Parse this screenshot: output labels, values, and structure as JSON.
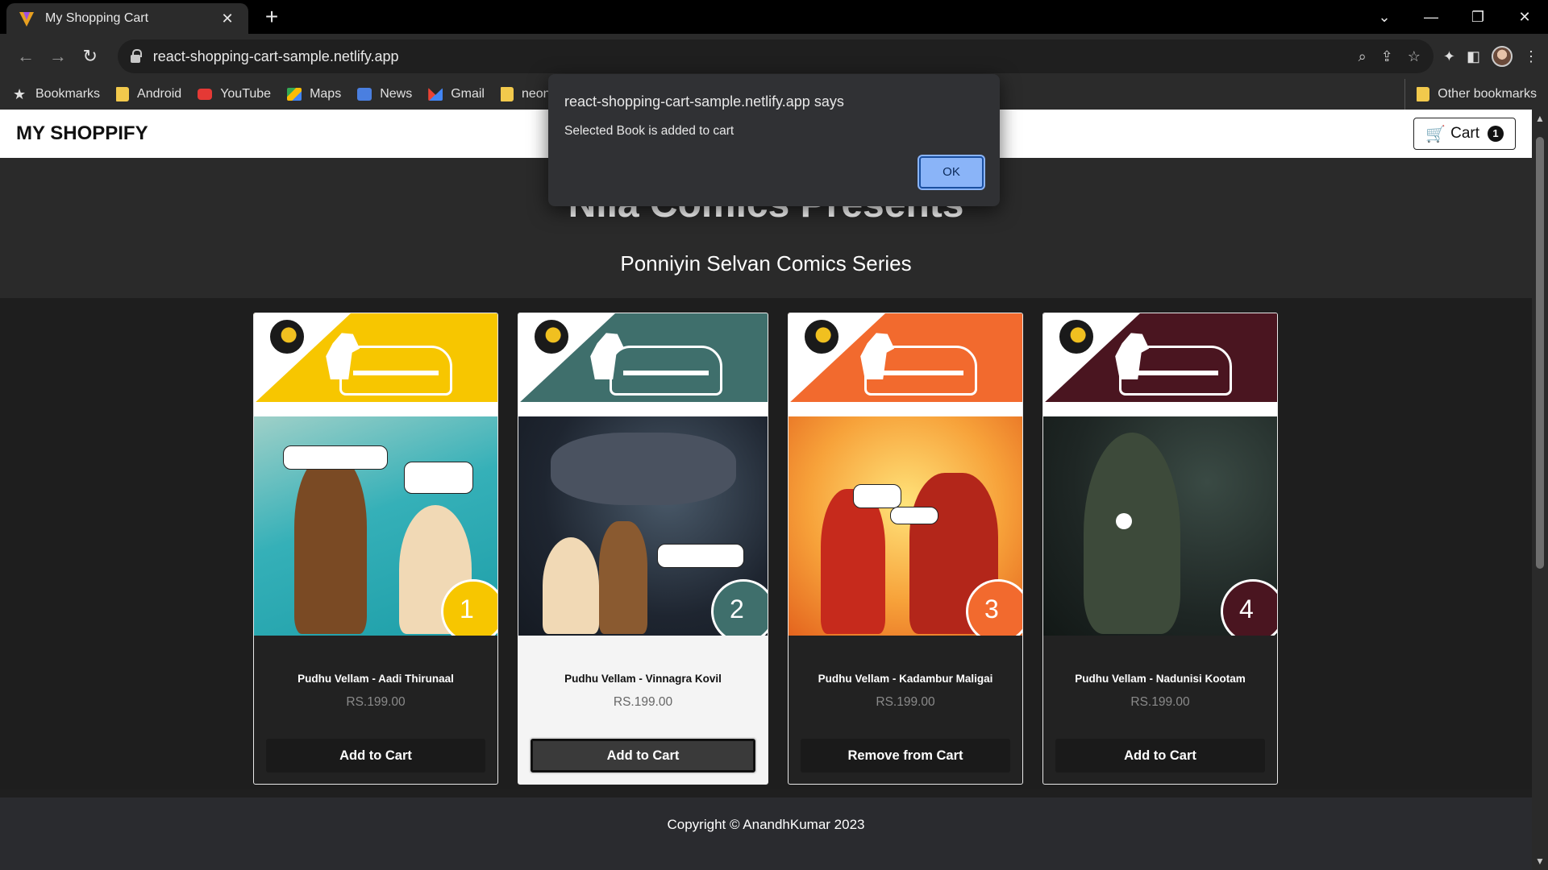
{
  "browser": {
    "tab_title": "My Shopping Cart",
    "tab_close": "✕",
    "new_tab": "+",
    "url": "react-shopping-cart-sample.netlify.app",
    "window_controls": {
      "chevron": "⌄",
      "minimize": "—",
      "restore": "❐",
      "close": "✕"
    },
    "nav": {
      "back": "←",
      "forward": "→",
      "reload": "↻"
    },
    "omni_icons": {
      "zoom": "⌕",
      "share": "⇪",
      "star": "☆"
    },
    "toolbar_icons": {
      "extensions": "✦",
      "sidepanel": "◧",
      "menu": "⋮"
    }
  },
  "bookmarks": [
    {
      "label": "Bookmarks",
      "icon": "star-icon"
    },
    {
      "label": "Android",
      "icon": "folder-icon"
    },
    {
      "label": "YouTube",
      "icon": "youtube-icon"
    },
    {
      "label": "Maps",
      "icon": "maps-icon"
    },
    {
      "label": "News",
      "icon": "news-icon"
    },
    {
      "label": "Gmail",
      "icon": "gmail-icon"
    },
    {
      "label": "neon",
      "icon": "folder-icon"
    }
  ],
  "other_bookmarks": "Other bookmarks",
  "site": {
    "brand": "MY SHOPPIFY",
    "cart_label": "Cart",
    "cart_icon": "🛒",
    "cart_count": "1",
    "hero_title": "Nila Comics Presents",
    "hero_subtitle": "Ponniyin Selvan Comics Series",
    "footer": "Copyright © AnandhKumar 2023"
  },
  "products": [
    {
      "name": "Pudhu Vellam - Aadi Thirunaal",
      "price": "RS.199.00",
      "button": "Add to Cart",
      "issue": "1",
      "accent": "#f7c600"
    },
    {
      "name": "Pudhu Vellam - Vinnagra Kovil",
      "price": "RS.199.00",
      "button": "Add to Cart",
      "issue": "2",
      "accent": "#3f6f6c"
    },
    {
      "name": "Pudhu Vellam - Kadambur Maligai",
      "price": "RS.199.00",
      "button": "Remove from Cart",
      "issue": "3",
      "accent": "#f26a2e"
    },
    {
      "name": "Pudhu Vellam - Nadunisi Kootam",
      "price": "RS.199.00",
      "button": "Add to Cart",
      "issue": "4",
      "accent": "#4a1520"
    }
  ],
  "dialog": {
    "title": "react-shopping-cart-sample.netlify.app says",
    "message": "Selected Book is added to cart",
    "ok": "OK"
  }
}
